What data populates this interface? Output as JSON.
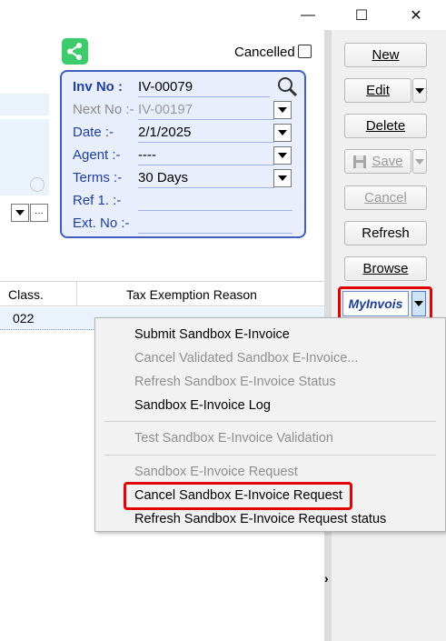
{
  "window": {
    "minimize_glyph": "—",
    "maximize_glyph": "☐",
    "close_glyph": "✕"
  },
  "header": {
    "cancelled_label": "Cancelled"
  },
  "invoice_panel": {
    "inv_no_label": "Inv No :",
    "inv_no_value": "IV-00079",
    "next_no_label": "Next No :-",
    "next_no_value": "IV-00197",
    "date_label": "Date :-",
    "date_value": "2/1/2025",
    "agent_label": "Agent :-",
    "agent_value": "----",
    "terms_label": "Terms :-",
    "terms_value": "30 Days",
    "ref_label": "Ref 1. :-",
    "ext_label": "Ext. No :-"
  },
  "toolbar": {
    "new_label": "New",
    "edit_label": "Edit",
    "delete_label": "Delete",
    "save_label": "Save",
    "cancel_label": "Cancel",
    "refresh_label": "Refresh",
    "browse_label": "Browse",
    "myinvois_logo_text": "MyInvois"
  },
  "table": {
    "columns": [
      "Class.",
      "Tax Exemption Reason"
    ],
    "rows": [
      [
        "022",
        ""
      ]
    ]
  },
  "menu": {
    "items": [
      {
        "label": "Submit Sandbox E-Invoice",
        "enabled": true
      },
      {
        "label": "Cancel Validated Sandbox E-Invoice...",
        "enabled": false
      },
      {
        "label": "Refresh Sandbox E-Invoice Status",
        "enabled": false
      },
      {
        "label": "Sandbox E-Invoice Log",
        "enabled": true
      },
      {
        "label": "Test Sandbox E-Invoice Validation",
        "enabled": false
      },
      {
        "label": "Sandbox E-Invoice Request",
        "enabled": false
      },
      {
        "label": "Cancel Sandbox E-Invoice Request",
        "enabled": true
      },
      {
        "label": "Refresh Sandbox E-Invoice Request status",
        "enabled": true
      }
    ]
  },
  "misc": {
    "ellipsis": "···",
    "expand_arrow": "›"
  },
  "colors": {
    "highlight": "#e30000",
    "panel_border": "#3f5fbf",
    "share_green": "#3ecb6b"
  }
}
